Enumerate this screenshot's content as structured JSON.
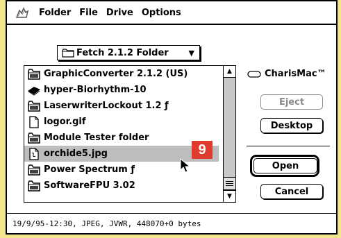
{
  "menubar": {
    "items": [
      "Folder",
      "File",
      "Drive",
      "Options"
    ]
  },
  "folder_popup": {
    "label": "Fetch 2.1.2 Folder",
    "arrow": "▼"
  },
  "files": [
    {
      "name": "GraphicConverter 2.1.2 (US)",
      "icon": "application-icon"
    },
    {
      "name": "hyper-Biorhythm-10",
      "icon": "hypercard-stack-icon"
    },
    {
      "name": "LaserwriterLockout 1.2 ƒ",
      "icon": "application-icon"
    },
    {
      "name": "logor.gif",
      "icon": "document-icon"
    },
    {
      "name": "Module Tester folder",
      "icon": "application-icon"
    },
    {
      "name": "orchide5.jpg",
      "icon": "jpeg-document-icon",
      "selected": true
    },
    {
      "name": "Power Spectrum ƒ",
      "icon": "application-icon"
    },
    {
      "name": "SoftwareFPU 3.02",
      "icon": "application-icon"
    }
  ],
  "drive": {
    "name": "CharisMac™"
  },
  "buttons": {
    "eject": "Eject",
    "desktop": "Desktop",
    "open": "Open",
    "cancel": "Cancel"
  },
  "status": "19/9/95-12:30, JPEG, JVWR, 448070+0 bytes",
  "badge": "9",
  "colors": {
    "background": "#f1e58d",
    "badge": "#e03a2e",
    "selection": "#bdbdbd"
  }
}
